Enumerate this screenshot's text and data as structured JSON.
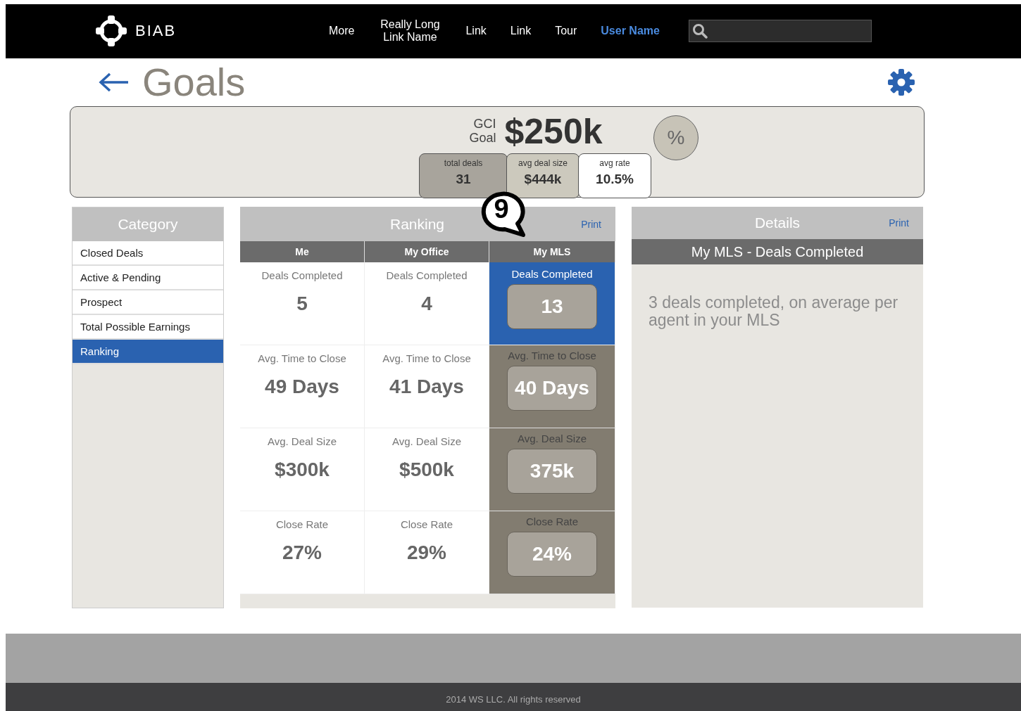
{
  "nav": {
    "logo": "BIAB",
    "links": [
      {
        "label": "More",
        "kind": "plain"
      },
      {
        "label": "Really Long Link Name",
        "kind": "plain"
      },
      {
        "label": "Link",
        "kind": "plain"
      },
      {
        "label": "Link",
        "kind": "plain"
      },
      {
        "label": "Tour",
        "kind": "plain"
      },
      {
        "label": "User Name",
        "kind": "user"
      }
    ]
  },
  "page": {
    "title": "Goals"
  },
  "goal": {
    "label_top": "GCI",
    "label_bottom": "Goal",
    "value": "$250k",
    "percent_button": "%",
    "stats": [
      {
        "label": "total deals",
        "value": "31",
        "kind": "dark"
      },
      {
        "label": "avg deal size",
        "value": "$444k",
        "kind": "mid"
      },
      {
        "label": "avg rate",
        "value": "10.5%",
        "kind": "plain"
      }
    ]
  },
  "sidebar": {
    "title": "Category",
    "items": [
      {
        "label": "Closed Deals",
        "selected": false
      },
      {
        "label": "Active & Pending",
        "selected": false
      },
      {
        "label": "Prospect",
        "selected": false
      },
      {
        "label": "Total Possible Earnings",
        "selected": false
      },
      {
        "label": "Ranking",
        "selected": true
      }
    ]
  },
  "ranking": {
    "title": "Ranking",
    "print": "Print",
    "annotation": "9",
    "columns": [
      "Me",
      "My Office",
      "My MLS"
    ],
    "rows": [
      {
        "cells": [
          {
            "label": "Deals Completed",
            "value": "5",
            "kind": "plain",
            "selected": false
          },
          {
            "label": "Deals Completed",
            "value": "4",
            "kind": "plain",
            "selected": false
          },
          {
            "label": "Deals Completed",
            "value": "13",
            "kind": "boxed",
            "selected": true
          }
        ]
      },
      {
        "cells": [
          {
            "label": "Avg. Time to Close",
            "value": "49 Days",
            "kind": "plain",
            "selected": false
          },
          {
            "label": "Avg. Time to Close",
            "value": "41 Days",
            "kind": "plain",
            "selected": false
          },
          {
            "label": "Avg. Time to Close",
            "value": "40 Days",
            "kind": "boxed",
            "selected": false
          }
        ]
      },
      {
        "cells": [
          {
            "label": "Avg. Deal Size",
            "value": "$300k",
            "kind": "plain",
            "selected": false
          },
          {
            "label": "Avg. Deal Size",
            "value": "$500k",
            "kind": "plain",
            "selected": false
          },
          {
            "label": "Avg. Deal Size",
            "value": "375k",
            "kind": "boxed",
            "selected": false
          }
        ]
      },
      {
        "cells": [
          {
            "label": "Close Rate",
            "value": "27%",
            "kind": "plain",
            "selected": false
          },
          {
            "label": "Close Rate",
            "value": "29%",
            "kind": "plain",
            "selected": false
          },
          {
            "label": "Close Rate",
            "value": "24%",
            "kind": "boxed",
            "selected": false
          }
        ]
      }
    ]
  },
  "details": {
    "title": "Details",
    "print": "Print",
    "subtitle": "My MLS - Deals Completed",
    "text": "3 deals completed, on average per agent in your MLS"
  },
  "footer": {
    "copyright": "2014 WS LLC. All rights reserved"
  }
}
